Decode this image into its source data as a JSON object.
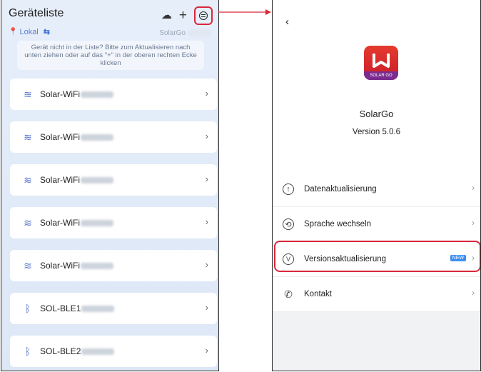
{
  "left": {
    "title": "Geräteliste",
    "location": "Lokal",
    "brand": "SolarGo",
    "hint": "Gerät nicht in der Liste? Bitte zum Aktualisieren nach unten ziehen oder auf das \"+\" in der oberen rechten Ecke klicken",
    "devices": [
      {
        "name": "Solar-WiFi",
        "icon": "wifi-icon"
      },
      {
        "name": "Solar-WiFi",
        "icon": "wifi-icon"
      },
      {
        "name": "Solar-WiFi",
        "icon": "wifi-icon"
      },
      {
        "name": "Solar-WiFi",
        "icon": "wifi-icon"
      },
      {
        "name": "Solar-WiFi",
        "icon": "wifi-icon"
      },
      {
        "name": "SOL-BLE1",
        "icon": "bluetooth-icon"
      },
      {
        "name": "SOL-BLE2",
        "icon": "bluetooth-icon"
      }
    ]
  },
  "right": {
    "app_name": "SolarGo",
    "version": "Version 5.0.6",
    "logo_text": "SOLAR GO",
    "menu": [
      {
        "label": "Datenaktualisierung",
        "icon": "upload-icon"
      },
      {
        "label": "Sprache wechseln",
        "icon": "language-icon"
      },
      {
        "label": "Versionsaktualisierung",
        "icon": "version-icon",
        "badge": "NEW"
      },
      {
        "label": "Kontakt",
        "icon": "phone-icon"
      }
    ]
  },
  "colors": {
    "highlight": "#d8283a",
    "accent": "#3d8ff2",
    "logo_red": "#e53a2e",
    "logo_band": "#7b2b8f"
  }
}
